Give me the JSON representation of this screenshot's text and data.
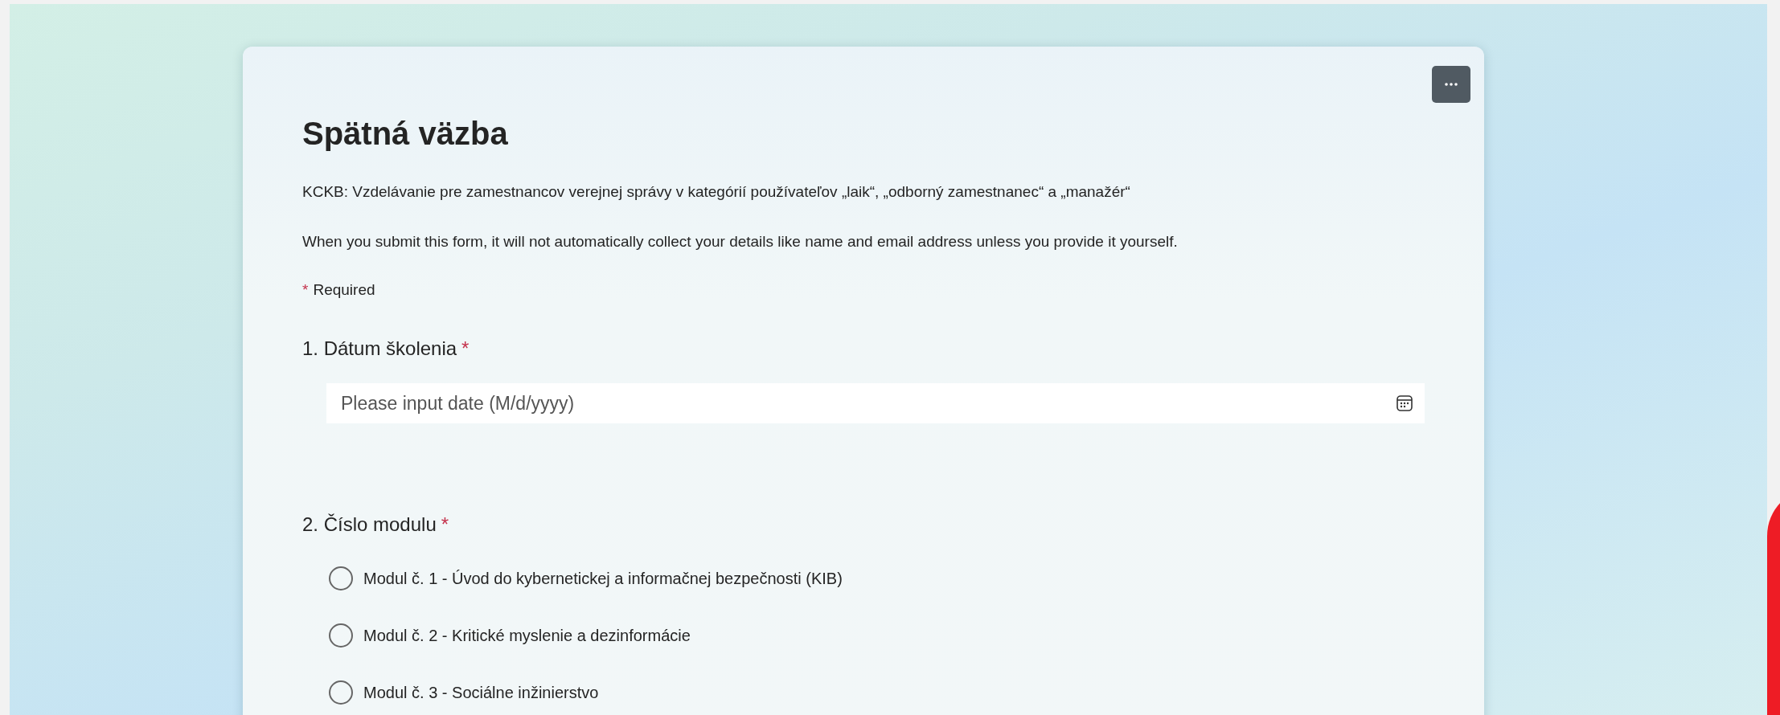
{
  "form": {
    "title": "Spätná väzba",
    "description": "KCKB: Vzdelávanie pre zamestnancov verejnej správy v kategórií používateľov „laik“, „odborný zamestnanec“ a „manažér“",
    "privacy_note": "When you submit this form, it will not automatically collect your details like name and email address unless you provide it yourself.",
    "required_note": {
      "mark": "*",
      "label": "Required"
    }
  },
  "questions": [
    {
      "kind": "date",
      "title": "1. Dátum školenia",
      "required_mark": "*",
      "placeholder": "Please input date (M/d/yyyy)"
    },
    {
      "kind": "choice",
      "title": "2. Číslo modulu",
      "required_mark": "*",
      "options": [
        {
          "label": "Modul č. 1 - Úvod do kybernetickej a informačnej bezpečnosti (KIB)",
          "selected": false
        },
        {
          "label": "Modul č. 2 - Kritické myslenie a dezinformácie",
          "selected": false
        },
        {
          "label": "Modul č. 3 - Sociálne inžinierstvo",
          "selected": false
        }
      ]
    }
  ]
}
